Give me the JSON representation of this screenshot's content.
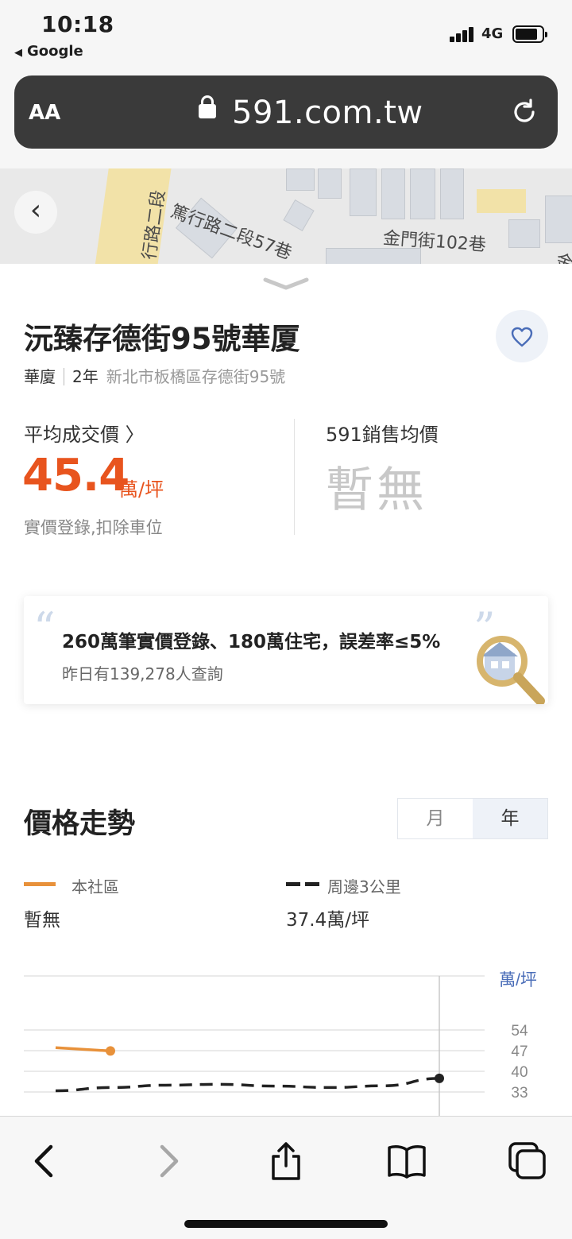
{
  "status": {
    "time": "10:18",
    "back_app": "Google",
    "network": "4G",
    "battery_level": 0.8
  },
  "browser": {
    "aa": "AA",
    "domain": "591.com.tw"
  },
  "map": {
    "street1": "篤行路二段57巷",
    "street2": "金門街102巷",
    "street3": "行路二段",
    "street4": "金"
  },
  "listing": {
    "title": "沅臻存德街95號華厦",
    "type": "華廈",
    "age": "2年",
    "address": "新北市板橋區存德街95號"
  },
  "prices": {
    "avg_label": "平均成交價 〉",
    "avg_value": "45.4",
    "avg_unit": "萬/坪",
    "avg_note": "實價登錄,扣除車位",
    "sale_label": "591銷售均價",
    "sale_value": "暫無"
  },
  "promo": {
    "main": "260萬筆實價登錄、180萬住宅，誤差率≤5%",
    "sub": "昨日有139,278人查詢"
  },
  "trend": {
    "title": "價格走勢",
    "toggle_month": "月",
    "toggle_year": "年",
    "selected": "年",
    "legend1_name": "本社區",
    "legend1_value": "暫無",
    "legend2_name": "周邊3公里",
    "legend2_value": "37.4萬/坪",
    "colors": {
      "community": "#e8913a",
      "nearby": "#222222"
    }
  },
  "chart_data": {
    "type": "line",
    "ylabel": "萬/坪",
    "y_ticks": [
      54,
      47,
      40,
      33
    ],
    "ylim": [
      26,
      61
    ],
    "series": [
      {
        "name": "本社區",
        "values": [
          48.0,
          46.9
        ]
      },
      {
        "name": "周邊3公里",
        "values": [
          33.4,
          34.5,
          35.3,
          35.6,
          35.0,
          34.5,
          35.1,
          37.6
        ]
      }
    ]
  },
  "icons": {
    "back": "chevron-left-icon",
    "forward": "chevron-right-icon",
    "share": "share-icon",
    "bookmarks": "book-icon",
    "tabs": "tabs-icon"
  }
}
